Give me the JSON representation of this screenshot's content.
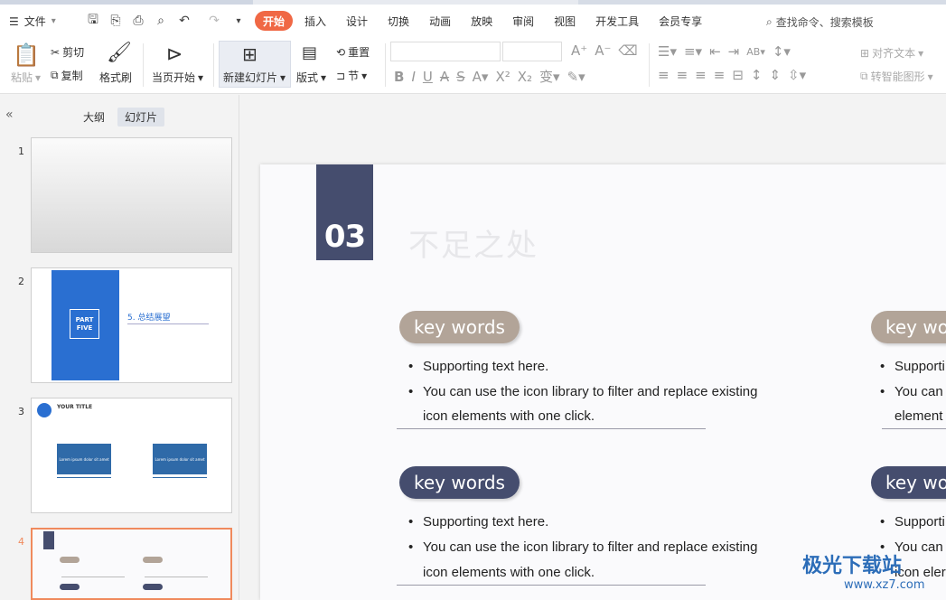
{
  "toolbar": {
    "file_label": "文件",
    "tabs": [
      "开始",
      "插入",
      "设计",
      "切换",
      "动画",
      "放映",
      "审阅",
      "视图",
      "开发工具",
      "会员专享"
    ],
    "search_label": "查找命令、搜索模板"
  },
  "ribbon": {
    "paste": "粘贴",
    "cut": "剪切",
    "copy": "复制",
    "format_painter": "格式刷",
    "from_current": "当页开始",
    "new_slide": "新建幻灯片",
    "layout": "版式",
    "reset": "重置",
    "section": "节",
    "align_text": "对齐文本",
    "smartart": "转智能图形"
  },
  "left_pane": {
    "tab_outline": "大纲",
    "tab_slides": "幻灯片",
    "slide_numbers": [
      "1",
      "2",
      "3",
      "4"
    ],
    "thumb2": {
      "part": "PART\nFIVE",
      "title": "5. 总结展望"
    },
    "thumb3": {
      "title": "YOUR TITLE",
      "box1": "Lorem ipsum dolor sit amet",
      "box2": "Lorem ipsum dolor sit amet"
    }
  },
  "slide": {
    "number": "03",
    "title": "不足之处",
    "blocks": [
      {
        "pill": "key words",
        "bullets": [
          "Supporting text here.",
          "You can use the icon library to filter and replace existing",
          "icon elements with one click."
        ]
      },
      {
        "pill": "key words",
        "bullets": [
          "Supporting text here.",
          "You can use the icon library to filter and replace existing",
          "icon elements with one click."
        ]
      }
    ],
    "right_pill_1": "key wor",
    "right_pill_2": "key wor",
    "right_bullets_1": [
      "Supporti",
      "You can",
      "element"
    ],
    "right_bullets_2": [
      "Supporti",
      "You can",
      "icon eler"
    ]
  },
  "watermark": {
    "line1": "极光下载站",
    "line2": "www.xz7.com"
  },
  "colors": {
    "accent": "#f06845",
    "navy": "#454d6e",
    "tan": "#b2a498",
    "slide_blue": "#2a6fd1"
  }
}
